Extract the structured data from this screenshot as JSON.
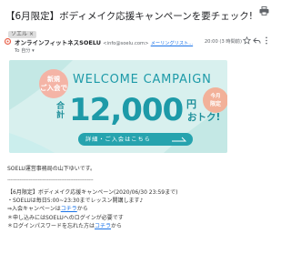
{
  "email": {
    "subject": "【6月限定】ボディメイク応援キャンペーンを要チェック!",
    "label_chip": "ソエル",
    "label_close": "×",
    "sender": {
      "name": "オンラインフィットネスSOELU",
      "email": "<info@soelu.com>",
      "link": "メーリングリスト..."
    },
    "timestamp": "20:00 (3 時間前)",
    "recipient": "To 自分 ▾"
  },
  "banner": {
    "badge_new_line1": "新規",
    "badge_new_line2": "ご入会で",
    "title": "WELCOME CAMPAIGN",
    "badge_limited_line1": "今月",
    "badge_limited_line2": "限定",
    "total_label": "合計",
    "amount": "12,000",
    "unit": "円",
    "otoku": "おトク!",
    "cta_label": "詳細・ご入会はこちら",
    "colors": {
      "background": "#d8f0ee",
      "teal": "#1d9aa8",
      "salmon": "#f4b4a6",
      "cta": "#26a3ae"
    }
  },
  "body": {
    "intro": "SOELU運営事務局の山下ゆいです。",
    "divider": "--------------------------------------------------------",
    "lines": [
      {
        "text": "【6月限定】ボディメイク応援キャンペーン(2020/06/30 23:59まで)",
        "link": "",
        "suffix": ""
      },
      {
        "text": "・SOELUは毎日5:00~23:30までレッスン開講します♪",
        "link": "",
        "suffix": ""
      },
      {
        "text": "⇒入会キャンペーンは",
        "link": "コチラ",
        "suffix": "から"
      },
      {
        "text": "＊申し込みにはSOELUへのログインが必要です",
        "link": "",
        "suffix": ""
      },
      {
        "text": "＊ログインパスワードを忘れた方は",
        "link": "コチラ",
        "suffix": "から"
      }
    ]
  }
}
